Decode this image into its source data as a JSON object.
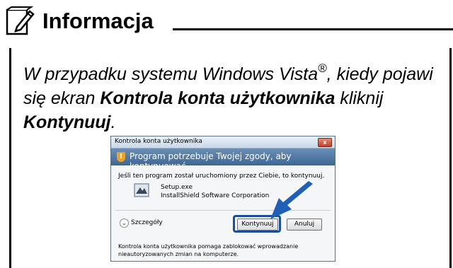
{
  "note": {
    "title": "Informacja",
    "text_1": "W przypadku systemu Windows Vista",
    "reg_mark": "®",
    "text_2": ", kiedy pojawi się ekran ",
    "bold_1": "Kontrola konta użytkownika",
    "text_3": " kliknij ",
    "bold_2": "Kontynuuj",
    "text_4": "."
  },
  "dialog": {
    "title": "Kontrola konta użytkownika",
    "close_label": "x",
    "banner": "Program potrzebuje Twojej zgody, aby kontynuować",
    "message": "Jeśli ten program został uruchomiony przez Ciebie, to kontynuuj.",
    "program_name": "Setup.exe",
    "publisher": "InstallShield Software Corporation",
    "details_label": "Szczegóły",
    "continue_label": "Kontynuuj",
    "cancel_label": "Anuluj",
    "footer": "Kontrola konta użytkownika pomaga zablokować wprowadzanie nieautoryzowanych zmian na komputerze."
  },
  "colors": {
    "banner_top": "#6b8fb6",
    "banner_bottom": "#3d6794",
    "arrow": "#1f5fb5",
    "highlight": "#1b4e9a"
  },
  "icons": [
    "note-pencil-icon",
    "shield-warning-icon",
    "program-icon",
    "chevron-down-icon",
    "pointer-arrow-icon"
  ]
}
